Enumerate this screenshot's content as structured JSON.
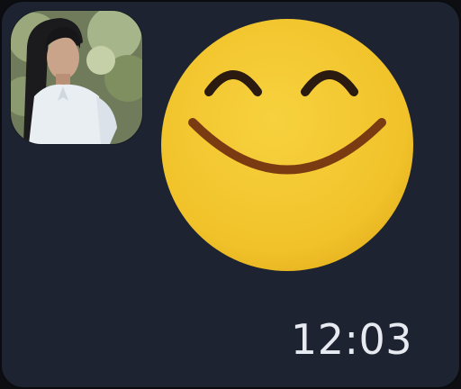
{
  "message": {
    "sticker_icon": "smiling-face-emoji-icon",
    "timestamp": "12:03"
  },
  "sender": {
    "avatar_description_icon": "user-avatar-photo"
  },
  "colors": {
    "bubble_background": "#1d2330",
    "emoji_face": "#f2c32f",
    "emoji_features": "#7a3a12",
    "time_text": "#e7eaf0"
  }
}
